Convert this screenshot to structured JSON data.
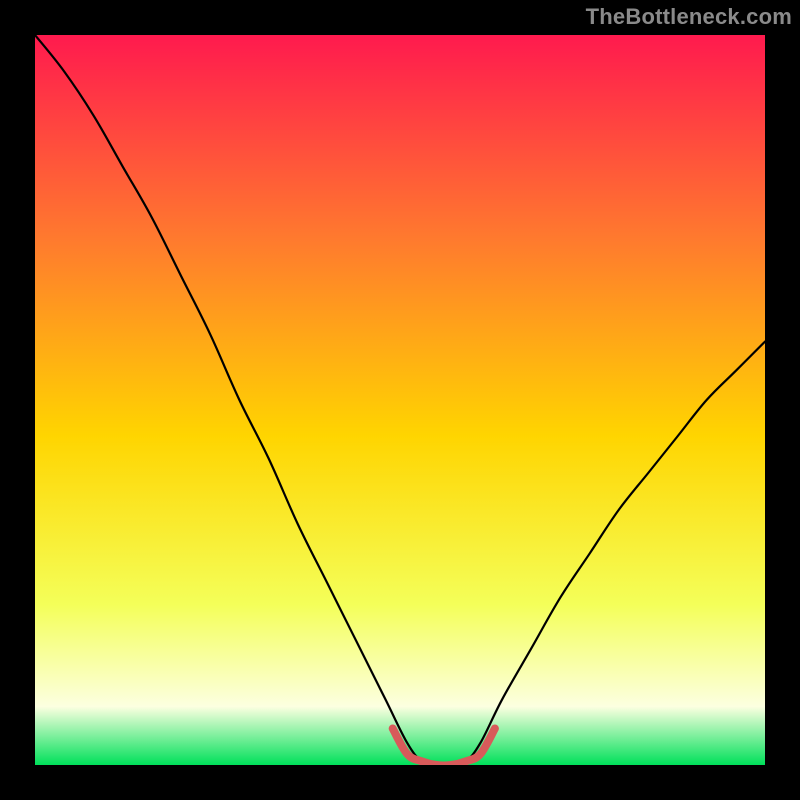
{
  "watermark": "TheBottleneck.com",
  "chart_data": {
    "type": "line",
    "title": "",
    "xlabel": "",
    "ylabel": "",
    "xlim": [
      0,
      100
    ],
    "ylim": [
      0,
      100
    ],
    "series": [
      {
        "name": "curve",
        "color": "#000000",
        "x": [
          0,
          4,
          8,
          12,
          16,
          20,
          24,
          28,
          32,
          36,
          40,
          44,
          48,
          51,
          53,
          55,
          57,
          59,
          61,
          64,
          68,
          72,
          76,
          80,
          84,
          88,
          92,
          96,
          100
        ],
        "y": [
          100,
          95,
          89,
          82,
          75,
          67,
          59,
          50,
          42,
          33,
          25,
          17,
          9,
          3,
          0.5,
          0,
          0,
          0.5,
          3,
          9,
          16,
          23,
          29,
          35,
          40,
          45,
          50,
          54,
          58
        ]
      },
      {
        "name": "highlight",
        "color": "#d85a5a",
        "x": [
          49,
          51,
          53,
          55,
          57,
          59,
          61,
          63
        ],
        "y": [
          5,
          1.5,
          0.5,
          0,
          0,
          0.5,
          1.5,
          5
        ]
      }
    ],
    "background_gradient": {
      "top": "#ff1a4e",
      "upper_mid": "#ff7a2e",
      "mid": "#ffd500",
      "lower_mid": "#f4ff59",
      "near_bottom": "#fcffe0",
      "bottom": "#00e05a"
    }
  }
}
